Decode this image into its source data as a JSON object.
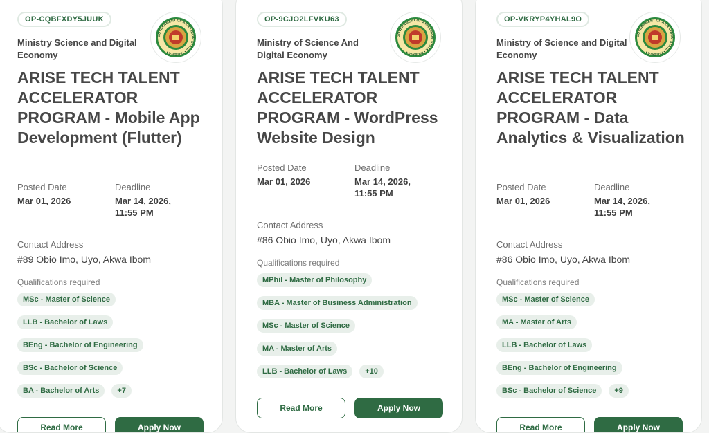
{
  "cards": [
    {
      "code": "OP-CQBFXDY5JUUK",
      "ministry": "Ministry Science and Digital Economy",
      "title": "ARISE TECH TALENT ACCELERATOR PROGRAM - Mobile App Development (Flutter)",
      "posted_label": "Posted Date",
      "posted_date": "Mar 01, 2026",
      "deadline_label": "Deadline",
      "deadline": "Mar 14, 2026, 11:55 PM",
      "contact_label": "Contact Address",
      "contact": "#89 Obio Imo, Uyo, Akwa Ibom",
      "qual_label": "Qualifications required",
      "qualifications": [
        "MSc - Master of Science",
        "LLB - Bachelor of Laws",
        "BEng - Bachelor of Engineering",
        "BSc - Bachelor of Science",
        "BA - Bachelor of Arts"
      ],
      "more": "+7",
      "read_more": "Read More",
      "apply_now": "Apply Now"
    },
    {
      "code": "OP-9CJO2LFVKU63",
      "ministry": "Ministry of Science And Digital Economy",
      "title": "ARISE TECH TALENT ACCELERATOR PROGRAM - WordPress Website Design",
      "posted_label": "Posted Date",
      "posted_date": "Mar 01, 2026",
      "deadline_label": "Deadline",
      "deadline": "Mar 14, 2026, 11:55 PM",
      "contact_label": "Contact Address",
      "contact": "#86 Obio Imo, Uyo, Akwa Ibom",
      "qual_label": "Qualifications required",
      "qualifications": [
        "MPhil - Master of Philosophy",
        "MBA - Master of Business Administration",
        "MSc - Master of Science",
        "MA - Master of Arts",
        "LLB - Bachelor of Laws"
      ],
      "more": "+10",
      "read_more": "Read More",
      "apply_now": "Apply Now"
    },
    {
      "code": "OP-VKRYP4YHAL9O",
      "ministry": "Ministry of Science and Digital Economy",
      "title": "ARISE TECH TALENT ACCELERATOR PROGRAM - Data Analytics & Visualization",
      "posted_label": "Posted Date",
      "posted_date": "Mar 01, 2026",
      "deadline_label": "Deadline",
      "deadline": "Mar 14, 2026, 11:55 PM",
      "contact_label": "Contact Address",
      "contact": "#86 Obio Imo, Uyo, Akwa Ibom",
      "qual_label": "Qualifications required",
      "qualifications": [
        "MSc - Master of Science",
        "MA - Master of Arts",
        "LLB - Bachelor of Laws",
        "BEng - Bachelor of Engineering",
        "BSc - Bachelor of Science"
      ],
      "more": "+9",
      "read_more": "Read More",
      "apply_now": "Apply Now"
    }
  ],
  "seal_text": "GOVERNMENT OF AKWA IBOM STATE • NIGERIA •",
  "colors": {
    "accent": "#2f6b43",
    "chip_bg": "#e8efea",
    "text": "#474747"
  }
}
